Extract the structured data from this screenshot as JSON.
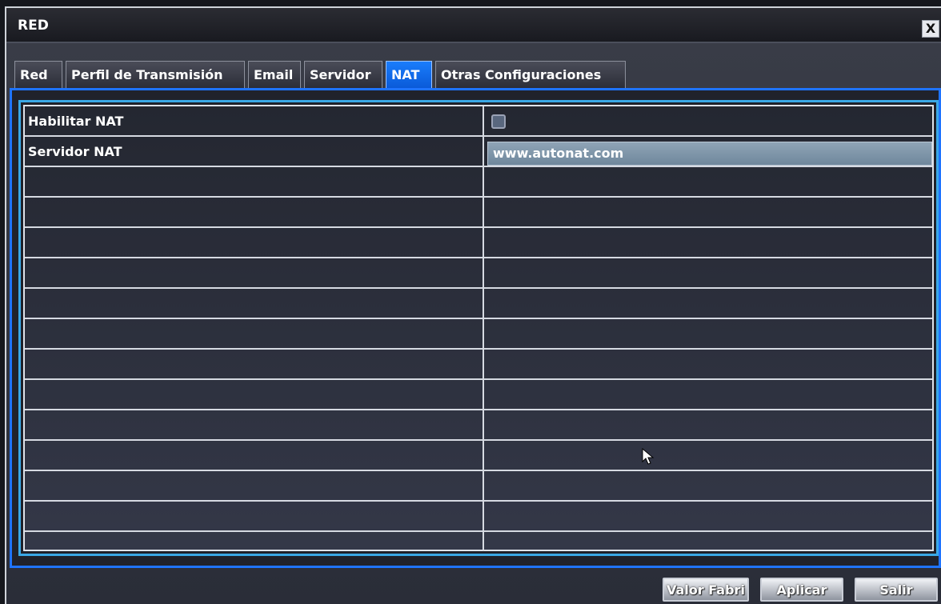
{
  "window": {
    "title": "RED",
    "close_symbol": "X"
  },
  "tabs": [
    {
      "label": "Red",
      "active": false
    },
    {
      "label": "Perfil de Transmisión",
      "active": false
    },
    {
      "label": "Email",
      "active": false
    },
    {
      "label": "Servidor",
      "active": false
    },
    {
      "label": "NAT",
      "active": true
    },
    {
      "label": "Otras Configuraciones",
      "active": false
    }
  ],
  "settings": {
    "enable_nat": {
      "label": "Habilitar NAT",
      "checked": false
    },
    "nat_server": {
      "label": "Servidor NAT",
      "value": "www.autonat.com"
    }
  },
  "buttons": {
    "default": "Valor Fabri",
    "apply": "Aplicar",
    "exit": "Salir"
  },
  "colors": {
    "accent_blue": "#0a5ad8",
    "panel_border": "#1f74ff",
    "grid_border": "#3aa8e6"
  }
}
